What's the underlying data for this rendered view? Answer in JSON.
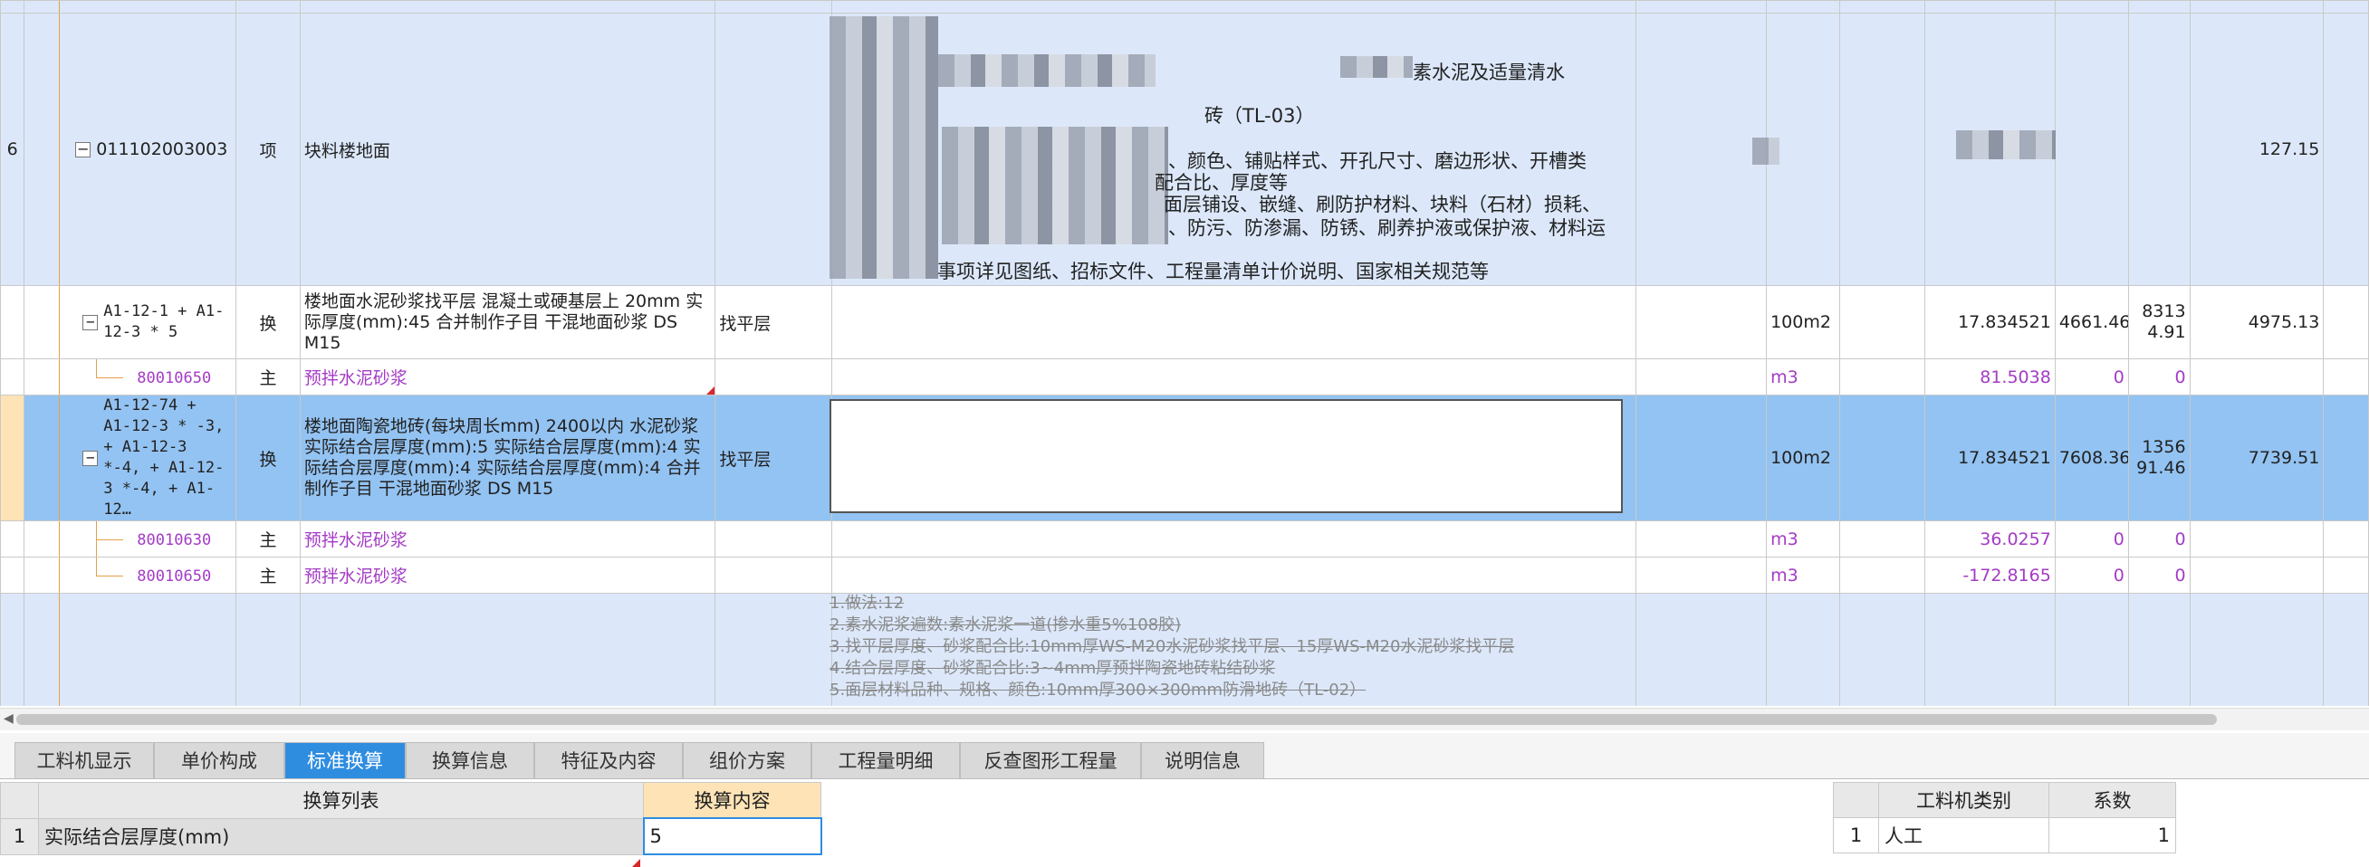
{
  "bill_rows": [
    {
      "no": "6",
      "code": "011102003003",
      "type": "项",
      "name": "块料楼地面",
      "spec": "",
      "unit": "",
      "qty": "",
      "price": "",
      "total": "",
      "amount": "127.15"
    },
    {
      "no": "",
      "code": "A1-12-1 + A1-12-3 * 5",
      "type": "换",
      "name": "楼地面水泥砂浆找平层 混凝土或硬基层上 20mm  实际厚度(mm):45  合并制作子目 干混地面砂浆 DS M15",
      "spec": "找平层",
      "unit": "100m2",
      "qty": "17.834521",
      "price": "4661.46",
      "total": "83134.91",
      "amount": "4975.13"
    },
    {
      "no": "",
      "code": "80010650",
      "type": "主",
      "name": "预拌水泥砂浆",
      "spec": "",
      "unit": "m3",
      "qty": "81.5038",
      "price": "0",
      "total": "0",
      "amount": ""
    },
    {
      "no": "",
      "code": "A1-12-74 + A1-12-3 * -3, + A1-12-3 *-4, + A1-12-3 *-4, + A1-12…",
      "type": "换",
      "name": "楼地面陶瓷地砖(每块周长mm) 2400以内 水泥砂浆  实际结合层厚度(mm):5  实际结合层厚度(mm):4  实际结合层厚度(mm):4  实际结合层厚度(mm):4  合并制作子目 干混地面砂浆 DS M15",
      "spec": "找平层",
      "unit": "100m2",
      "qty": "17.834521",
      "price": "7608.36",
      "total": "135691.46",
      "amount": "7739.51"
    },
    {
      "no": "",
      "code": "80010630",
      "type": "主",
      "name": "预拌水泥砂浆",
      "spec": "",
      "unit": "m3",
      "qty": "36.0257",
      "price": "0",
      "total": "0",
      "amount": ""
    },
    {
      "no": "",
      "code": "80010650",
      "type": "主",
      "name": "预拌水泥砂浆",
      "spec": "",
      "unit": "m3",
      "qty": "-172.8165",
      "price": "0",
      "total": "0",
      "amount": ""
    }
  ],
  "feature_text": {
    "line1": "素水泥及适量清水",
    "line2": "砖（TL-03）",
    "line3": "、颜色、铺贴样式、开孔尺寸、磨边形状、开槽类",
    "line4": "配合比、厚度等",
    "line5": "面层铺设、嵌缝、刷防护材料、块料（石材）损耗、",
    "line6": "、防污、防渗漏、防锈、刷养护液或保护液、材料运",
    "line7": "事项详见图纸、招标文件、工程量清单计价说明、国家相关规范等"
  },
  "struck_text": [
    "1.做法:12",
    "2.素水泥浆遍数:素水泥浆一道(掺水重5%108胶)",
    "3.找平层厚度、砂浆配合比:10mm厚WS-M20水泥砂浆找平层、15厚WS-M20水泥砂浆找平层",
    "4.结合层厚度、砂浆配合比:3~4mm厚预拌陶瓷地砖粘结砂浆",
    "5.面层材料品种、规格、颜色:10mm厚300×300mm防滑地砖（TL-02）"
  ],
  "tabs": [
    "工料机显示",
    "单价构成",
    "标准换算",
    "换算信息",
    "特征及内容",
    "组价方案",
    "工程量明细",
    "反查图形工程量",
    "说明信息"
  ],
  "active_tab": "标准换算",
  "conversion": {
    "col_list": "换算列表",
    "col_content": "换算内容",
    "row_no": "1",
    "row_label": "实际结合层厚度(mm)",
    "row_value": "5"
  },
  "coef": {
    "col_category": "工料机类别",
    "col_factor": "系数",
    "row_no": "1",
    "row_category": "人工",
    "row_factor": "1"
  },
  "colors": {
    "selected_row": "#93c3f2",
    "bill_row": "#dce8fa",
    "active_tab": "#2f8de0",
    "material_text": "#a43bc5"
  }
}
